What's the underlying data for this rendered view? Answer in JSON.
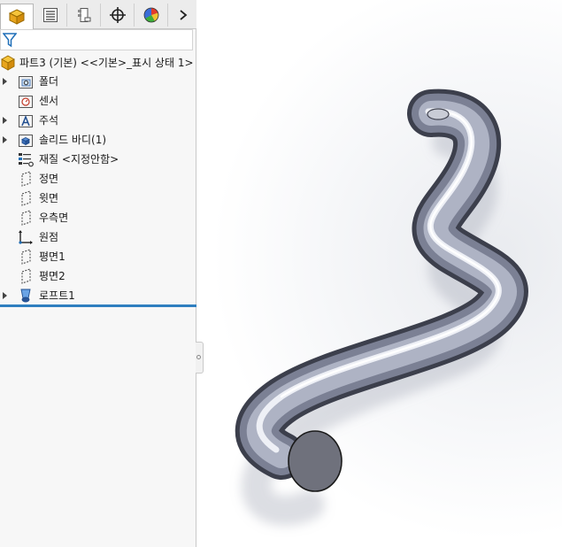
{
  "tabs": [
    {
      "id": "feature-manager",
      "icon": "feature-manager-icon",
      "active": true
    },
    {
      "id": "property-manager",
      "icon": "property-manager-icon"
    },
    {
      "id": "configuration-manager",
      "icon": "configuration-manager-icon"
    },
    {
      "id": "dimxpert-manager",
      "icon": "dimxpert-crosshair-icon"
    },
    {
      "id": "display-manager",
      "icon": "appearance-ball-icon"
    }
  ],
  "tabs_more_icon": "chevron-right-icon",
  "filter_icon": "filter-funnel-icon",
  "tree": {
    "root_label": "파트3 (기본) <<기본>_표시 상태 1>",
    "items": [
      {
        "label": "폴더",
        "icon": "history-folder-icon",
        "expandable": true
      },
      {
        "label": "센서",
        "icon": "sensor-folder-icon",
        "expandable": false
      },
      {
        "label": "주석",
        "icon": "annotation-folder-icon",
        "expandable": true
      },
      {
        "label": "솔리드 바디(1)",
        "icon": "solid-bodies-folder-icon",
        "expandable": true
      },
      {
        "label": "재질 <지정안함>",
        "icon": "material-icon",
        "expandable": false
      },
      {
        "label": "정면",
        "icon": "plane-icon",
        "expandable": false
      },
      {
        "label": "윗면",
        "icon": "plane-icon",
        "expandable": false
      },
      {
        "label": "우측면",
        "icon": "plane-icon",
        "expandable": false
      },
      {
        "label": "원점",
        "icon": "origin-icon",
        "expandable": false
      },
      {
        "label": "평면1",
        "icon": "plane-icon",
        "expandable": false
      },
      {
        "label": "평면2",
        "icon": "plane-icon",
        "expandable": false
      },
      {
        "label": "로프트1",
        "icon": "loft-feature-icon",
        "expandable": true
      }
    ]
  },
  "colors": {
    "rollback_bar": "#2f7fc0",
    "panel_bg": "#f7f7f7",
    "tab_bg": "#ececec"
  }
}
